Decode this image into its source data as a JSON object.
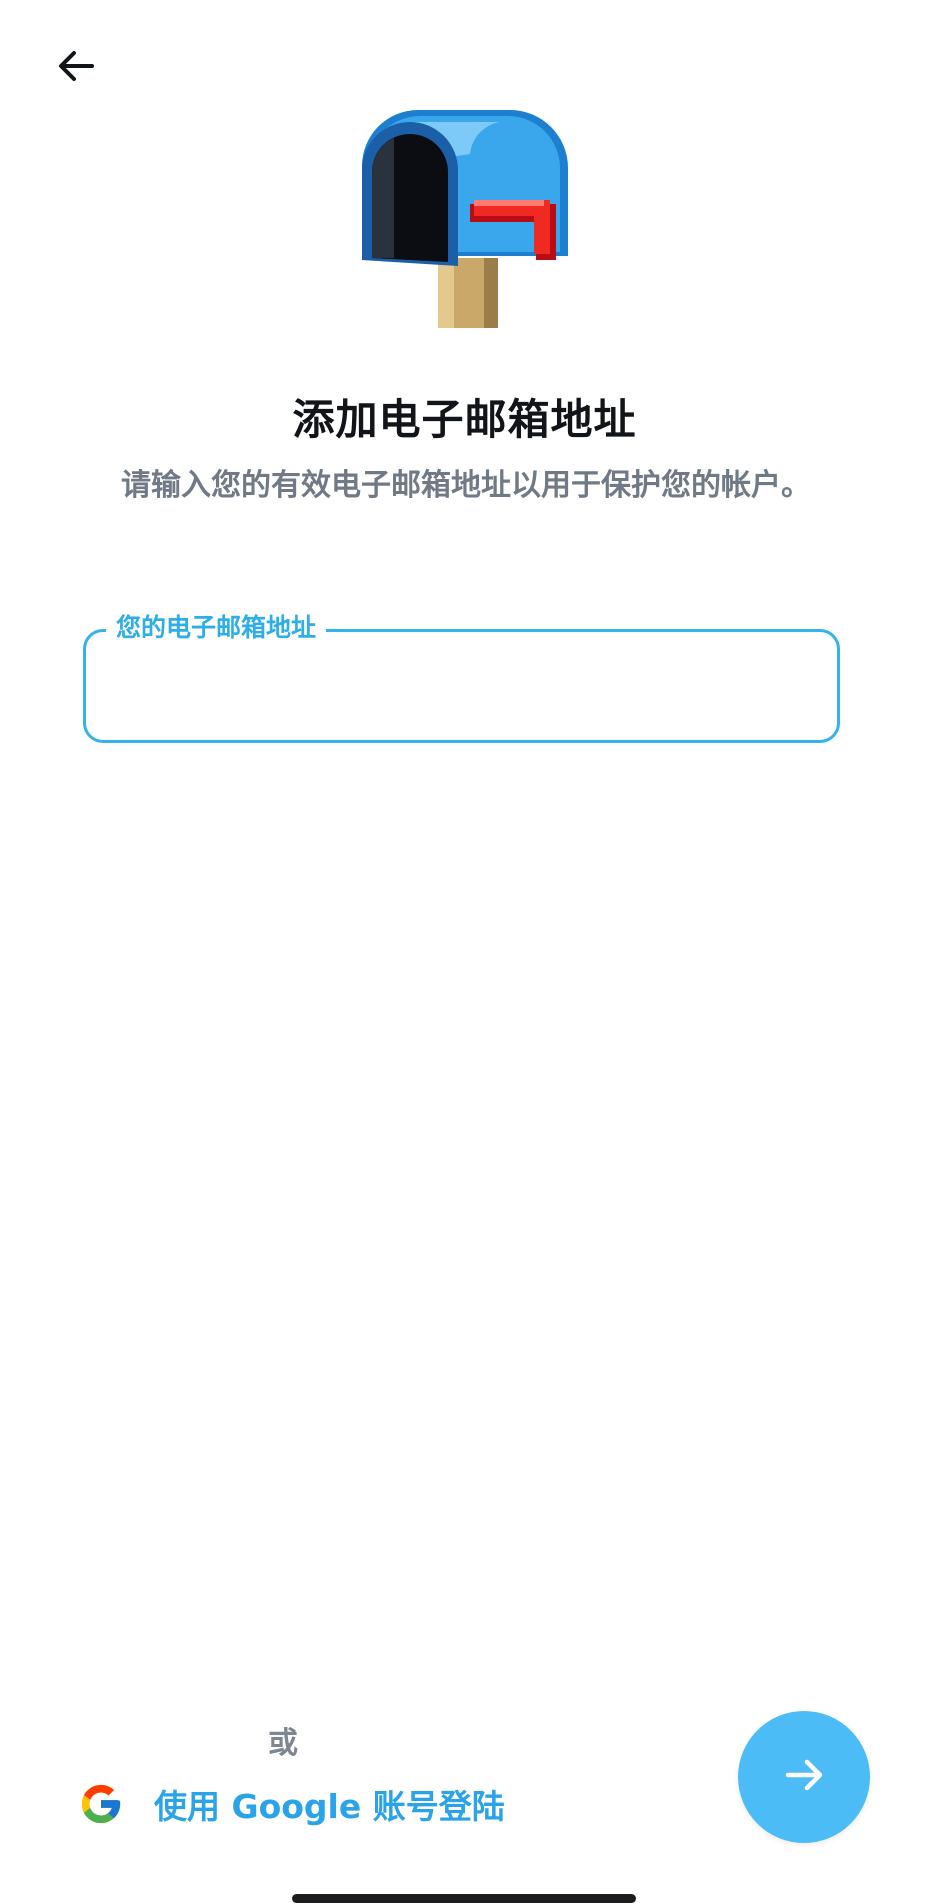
{
  "header": {
    "back_icon": "arrow-left-icon"
  },
  "illustration": {
    "icon": "mailbox-icon"
  },
  "title": "添加电子邮箱地址",
  "subtitle": "请输入您的有效电子邮箱地址以用于保护您的帐户。",
  "email_field": {
    "label": "您的电子邮箱地址",
    "value": ""
  },
  "divider": {
    "or_label": "或"
  },
  "google_login": {
    "icon": "google-icon",
    "label": "使用 Google 账号登陆"
  },
  "next_button": {
    "icon": "arrow-right-icon"
  },
  "colors": {
    "accent": "#34b3ea",
    "fab": "#4cbcf7",
    "google_text": "#2aa3e8",
    "muted_text": "#707a86"
  }
}
